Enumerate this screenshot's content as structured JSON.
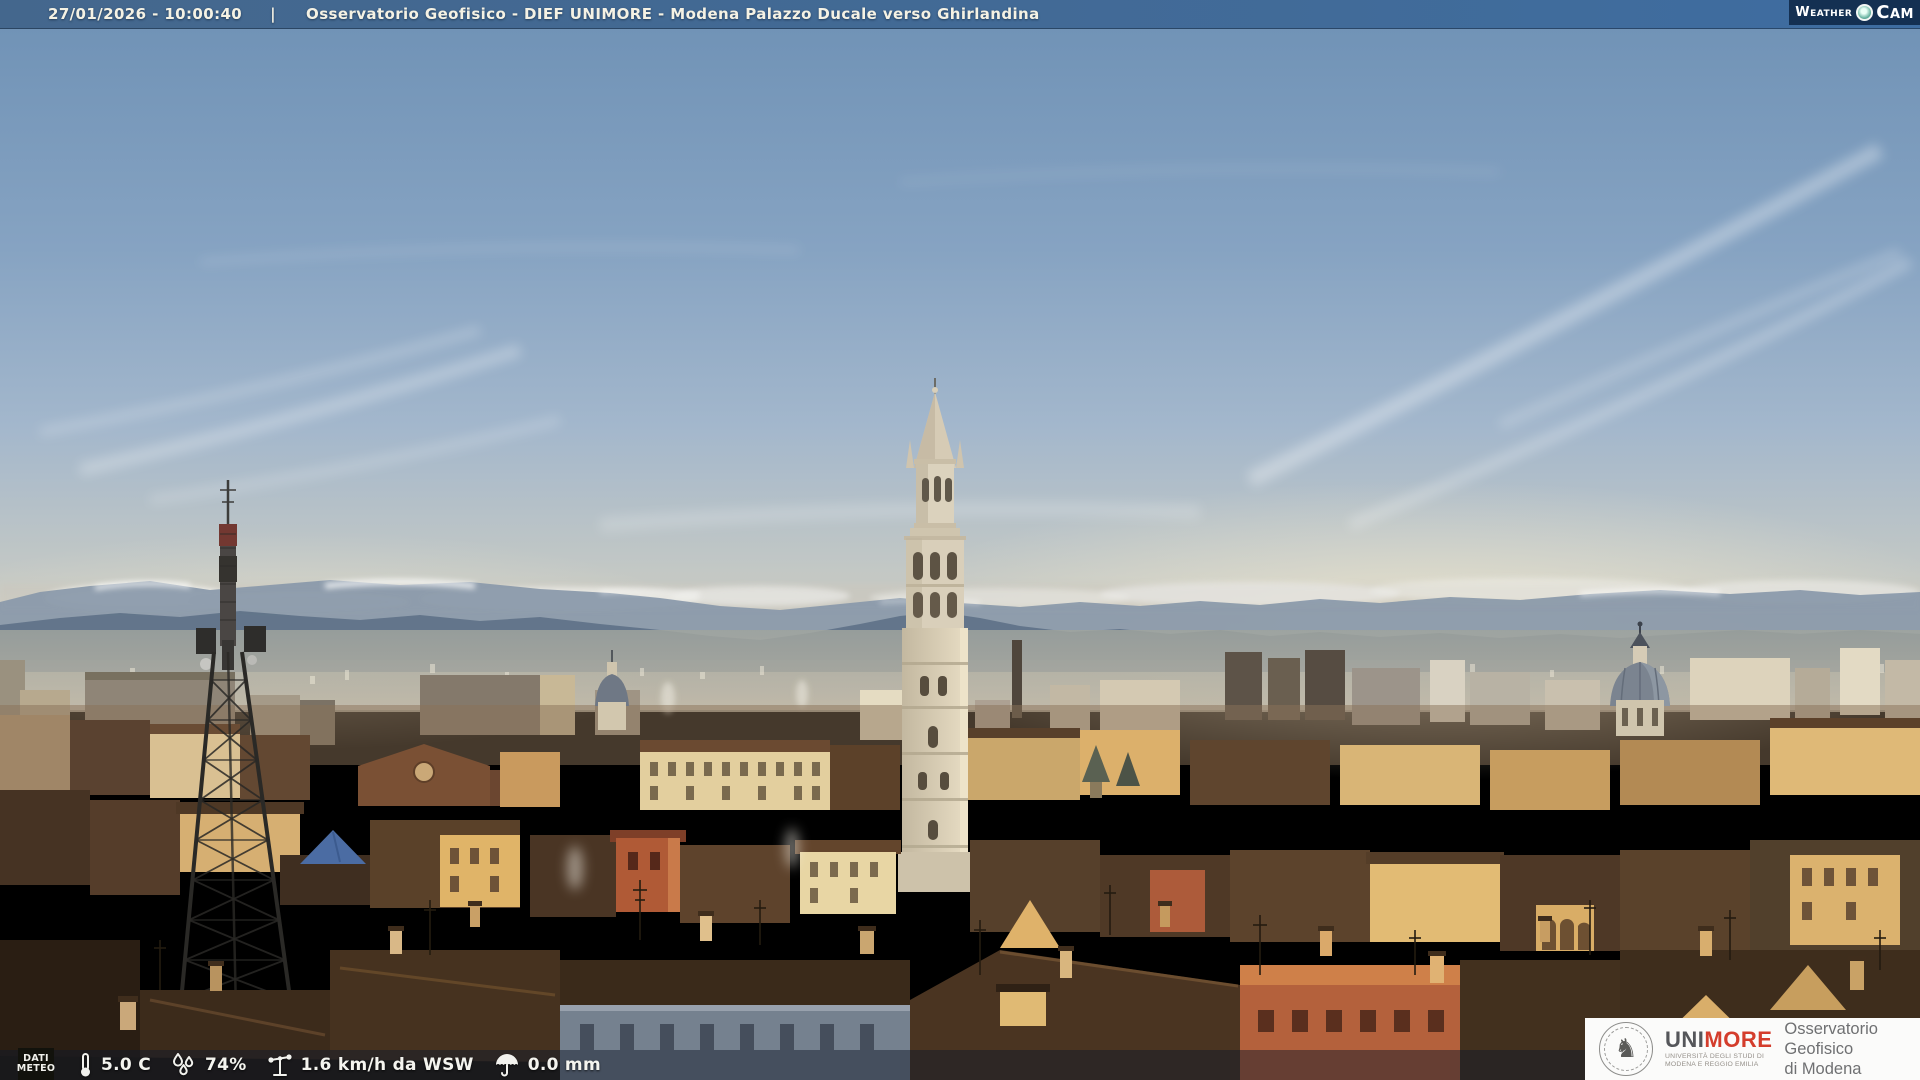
{
  "topbar": {
    "datetime": "27/01/2026 - 10:00:40",
    "separator": "|",
    "title": "Osservatorio Geofisico - DIEF UNIMORE - Modena Palazzo Ducale verso Ghirlandina",
    "background_color": "#44678d",
    "text_color": "#f5f2e4"
  },
  "weathercam_logo": {
    "word1": "Weather",
    "word2": "Cam",
    "background_color": "#143052",
    "dot_color": "#66b2a0"
  },
  "meteo_bar": {
    "label_line1": "DATI",
    "label_line2": "METEO",
    "background_color": "rgba(16,26,42,0.48)",
    "readings": [
      {
        "icon": "thermometer-icon",
        "value": "5.0 C"
      },
      {
        "icon": "humidity-drops-icon",
        "value": "74%"
      },
      {
        "icon": "anemometer-icon",
        "value": "1.6 km/h da WSW"
      },
      {
        "icon": "rain-umbrella-icon",
        "value": "0.0 mm"
      }
    ]
  },
  "unimore_panel": {
    "brand_uni": "UNI",
    "brand_more": "MORE",
    "brand_more_color": "#d43d2c",
    "seal_icon": "unimore-seal-icon",
    "subtitle_line1": "UNIVERSITÀ DEGLI STUDI DI",
    "subtitle_line2": "MODENA E REGGIO EMILIA",
    "org_line1": "Osservatorio Geofisico",
    "org_line2": "di Modena"
  }
}
